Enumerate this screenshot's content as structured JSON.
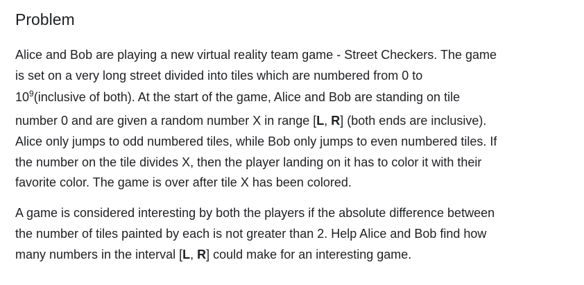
{
  "heading": "Problem",
  "para1": {
    "l1": "Alice and Bob are playing a new virtual reality team game - Street Checkers. The game",
    "l2": "is set on a very long street divided into tiles which are numbered from 0 to",
    "l3_base": "10",
    "l3_exp": "9",
    "l3_rest": "(inclusive of both). At the start of the game, Alice and Bob are standing on tile",
    "l4_pre": "number 0 and are given a random number X in range [",
    "l4_L": "L",
    "l4_comma": ", ",
    "l4_R": "R",
    "l4_post": "] (both ends are inclusive).",
    "l5": "Alice only jumps to odd numbered tiles, while Bob only jumps to even numbered tiles. If",
    "l6": "the number on the tile divides X, then the player landing on it has to color it with their",
    "l7": "favorite color. The game is over after tile X has been colored."
  },
  "para2": {
    "l1": "A game is considered interesting by both the players if the absolute difference between",
    "l2": "the number of tiles painted by each is not greater than 2. Help Alice and Bob find how",
    "l3_pre": "many numbers in the interval [",
    "l3_L": "L",
    "l3_comma": ", ",
    "l3_R": "R",
    "l3_post": "] could make for an interesting game."
  }
}
